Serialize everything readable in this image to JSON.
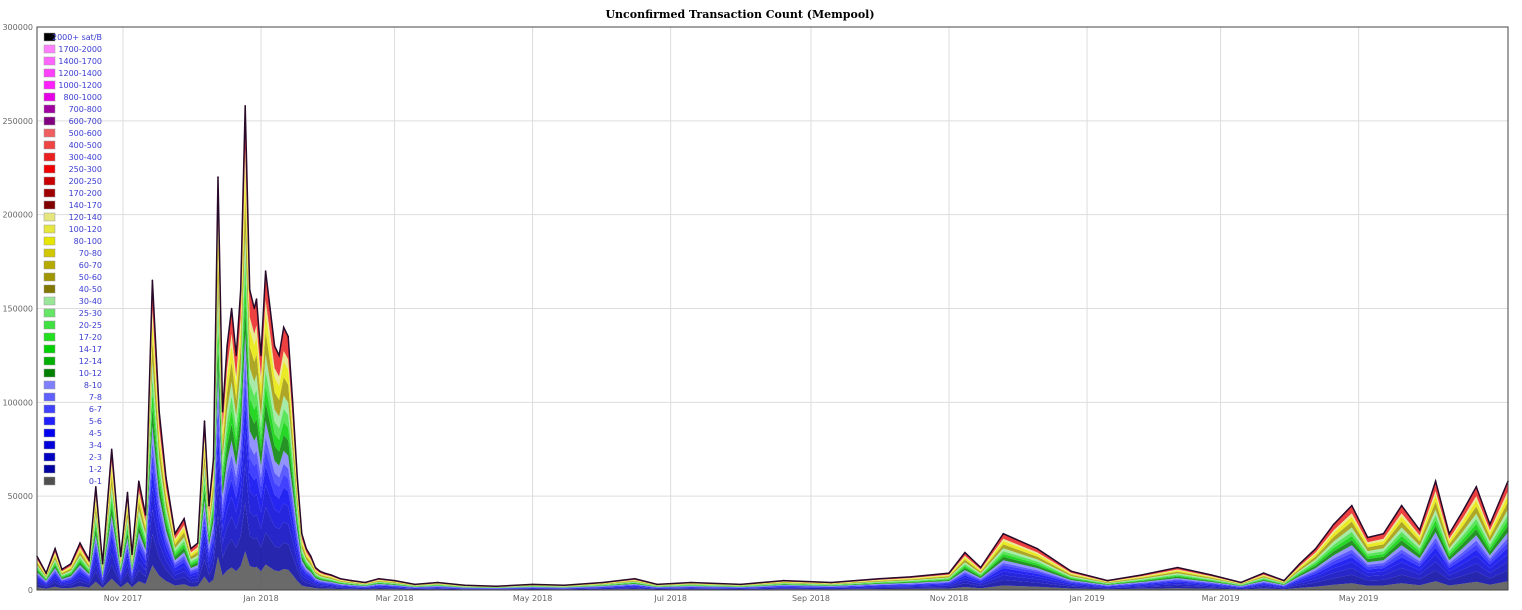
{
  "chart_data": {
    "type": "area",
    "title": "Unconfirmed Transaction Count (Mempool)",
    "xlabel": "",
    "ylabel": "",
    "ylim": [
      0,
      300000
    ],
    "y_ticks": [
      0,
      50000,
      100000,
      150000,
      200000,
      250000,
      300000
    ],
    "y_tick_labels": [
      "0",
      "50000",
      "100000",
      "150000",
      "200000",
      "250000",
      "300000"
    ],
    "x_range": [
      "2017-09-24",
      "2019-07-06"
    ],
    "x_ticks": [
      "2017-11-01",
      "2018-01-01",
      "2018-03-01",
      "2018-05-01",
      "2018-07-01",
      "2018-09-01",
      "2018-11-01",
      "2019-01-01",
      "2019-03-01",
      "2019-05-01"
    ],
    "x_tick_labels": [
      "Nov 2017",
      "Jan 2018",
      "Mar 2018",
      "May 2018",
      "Jul 2018",
      "Sep 2018",
      "Nov 2018",
      "Jan 2019",
      "Mar 2019",
      "May 2019"
    ],
    "grid": true,
    "legend_position": "top-left",
    "stacked": true,
    "legend": [
      {
        "label": "2000+ sat/B",
        "color": "#000000"
      },
      {
        "label": "1700-2000",
        "color": "#ff80ff"
      },
      {
        "label": "1400-1700",
        "color": "#ff66ff"
      },
      {
        "label": "1200-1400",
        "color": "#ff40ff"
      },
      {
        "label": "1000-1200",
        "color": "#ff1fff"
      },
      {
        "label": "800-1000",
        "color": "#e600e6"
      },
      {
        "label": "700-800",
        "color": "#a000a0"
      },
      {
        "label": "600-700",
        "color": "#800080"
      },
      {
        "label": "500-600",
        "color": "#f06060"
      },
      {
        "label": "400-500",
        "color": "#ee4444"
      },
      {
        "label": "300-400",
        "color": "#ea2020"
      },
      {
        "label": "250-300",
        "color": "#f00000"
      },
      {
        "label": "200-250",
        "color": "#c80000"
      },
      {
        "label": "170-200",
        "color": "#a00000"
      },
      {
        "label": "140-170",
        "color": "#800000"
      },
      {
        "label": "120-140",
        "color": "#e6e680"
      },
      {
        "label": "100-120",
        "color": "#e6e640"
      },
      {
        "label": "80-100",
        "color": "#e6e600"
      },
      {
        "label": "70-80",
        "color": "#d2c800"
      },
      {
        "label": "60-70",
        "color": "#b4aa00"
      },
      {
        "label": "50-60",
        "color": "#a09600"
      },
      {
        "label": "40-50",
        "color": "#827800"
      },
      {
        "label": "30-40",
        "color": "#99e699"
      },
      {
        "label": "25-30",
        "color": "#66e666"
      },
      {
        "label": "20-25",
        "color": "#40e040"
      },
      {
        "label": "17-20",
        "color": "#20e020"
      },
      {
        "label": "14-17",
        "color": "#00d000"
      },
      {
        "label": "12-14",
        "color": "#00b000"
      },
      {
        "label": "10-12",
        "color": "#008000"
      },
      {
        "label": "8-10",
        "color": "#8080ff"
      },
      {
        "label": "7-8",
        "color": "#6060ff"
      },
      {
        "label": "6-7",
        "color": "#4040ff"
      },
      {
        "label": "5-6",
        "color": "#2020ff"
      },
      {
        "label": "4-5",
        "color": "#0000f0"
      },
      {
        "label": "3-4",
        "color": "#0000d8"
      },
      {
        "label": "2-3",
        "color": "#0000c0"
      },
      {
        "label": "1-2",
        "color": "#0000a0"
      },
      {
        "label": "0-1",
        "color": "#505050"
      }
    ],
    "total_series": {
      "name": "total",
      "x": [
        "2017-09-24",
        "2017-09-28",
        "2017-10-02",
        "2017-10-05",
        "2017-10-09",
        "2017-10-13",
        "2017-10-17",
        "2017-10-20",
        "2017-10-23",
        "2017-10-27",
        "2017-10-31",
        "2017-11-03",
        "2017-11-05",
        "2017-11-08",
        "2017-11-11",
        "2017-11-14",
        "2017-11-17",
        "2017-11-20",
        "2017-11-24",
        "2017-11-28",
        "2017-12-01",
        "2017-12-04",
        "2017-12-07",
        "2017-12-09",
        "2017-12-11",
        "2017-12-13",
        "2017-12-15",
        "2017-12-17",
        "2017-12-19",
        "2017-12-21",
        "2017-12-23",
        "2017-12-25",
        "2017-12-27",
        "2017-12-29",
        "2017-12-30",
        "2018-01-01",
        "2018-01-03",
        "2018-01-05",
        "2018-01-07",
        "2018-01-09",
        "2018-01-11",
        "2018-01-13",
        "2018-01-15",
        "2018-01-17",
        "2018-01-19",
        "2018-01-21",
        "2018-01-23",
        "2018-01-25",
        "2018-01-27",
        "2018-01-29",
        "2018-02-01",
        "2018-02-05",
        "2018-02-10",
        "2018-02-16",
        "2018-02-22",
        "2018-03-01",
        "2018-03-10",
        "2018-03-20",
        "2018-04-01",
        "2018-04-15",
        "2018-05-01",
        "2018-05-15",
        "2018-06-01",
        "2018-06-15",
        "2018-06-25",
        "2018-07-10",
        "2018-08-01",
        "2018-08-20",
        "2018-09-10",
        "2018-10-01",
        "2018-10-15",
        "2018-11-01",
        "2018-11-08",
        "2018-11-15",
        "2018-11-25",
        "2018-12-10",
        "2018-12-25",
        "2019-01-10",
        "2019-01-25",
        "2019-02-10",
        "2019-02-25",
        "2019-03-10",
        "2019-03-20",
        "2019-03-29",
        "2019-04-05",
        "2019-04-12",
        "2019-04-20",
        "2019-04-28",
        "2019-05-05",
        "2019-05-12",
        "2019-05-20",
        "2019-05-28",
        "2019-06-04",
        "2019-06-10",
        "2019-06-16",
        "2019-06-22",
        "2019-06-28",
        "2019-07-06"
      ],
      "y": [
        18000,
        9000,
        22000,
        11000,
        14000,
        25000,
        16000,
        55000,
        14000,
        75000,
        18000,
        52000,
        19000,
        58000,
        40000,
        165000,
        95000,
        60000,
        30000,
        38000,
        22000,
        25000,
        90000,
        45000,
        70000,
        220000,
        95000,
        130000,
        150000,
        125000,
        160000,
        258000,
        160000,
        150000,
        155000,
        125000,
        170000,
        150000,
        130000,
        125000,
        140000,
        135000,
        100000,
        60000,
        30000,
        22000,
        18000,
        12000,
        10000,
        9000,
        8000,
        6000,
        5000,
        4000,
        6000,
        5000,
        3000,
        4000,
        2500,
        2000,
        3000,
        2500,
        4000,
        6000,
        3000,
        4000,
        3000,
        5000,
        4000,
        6000,
        7000,
        9000,
        20000,
        12000,
        30000,
        22000,
        10000,
        5000,
        8000,
        12000,
        8000,
        4000,
        9000,
        5000,
        14000,
        22000,
        35000,
        45000,
        28000,
        30000,
        45000,
        32000,
        58000,
        30000,
        42000,
        55000,
        35000,
        58000
      ],
      "bands": [
        {
          "name": "0-1",
          "share": 0.08
        },
        {
          "name": "1-2",
          "share": 0.1
        },
        {
          "name": "2-3",
          "share": 0.08
        },
        {
          "name": "3-4",
          "share": 0.07
        },
        {
          "name": "4-5",
          "share": 0.06
        },
        {
          "name": "5-6",
          "share": 0.05
        },
        {
          "name": "6-7",
          "share": 0.04
        },
        {
          "name": "8-10",
          "share": 0.05
        },
        {
          "name": "10-12",
          "share": 0.06
        },
        {
          "name": "14-17",
          "share": 0.05
        },
        {
          "name": "20-25",
          "share": 0.05
        },
        {
          "name": "30-40",
          "share": 0.05
        },
        {
          "name": "50-60",
          "share": 0.07
        },
        {
          "name": "80-100",
          "share": 0.06
        },
        {
          "name": "120-140",
          "share": 0.04
        },
        {
          "name": "300-400",
          "share": 0.09
        }
      ]
    }
  }
}
